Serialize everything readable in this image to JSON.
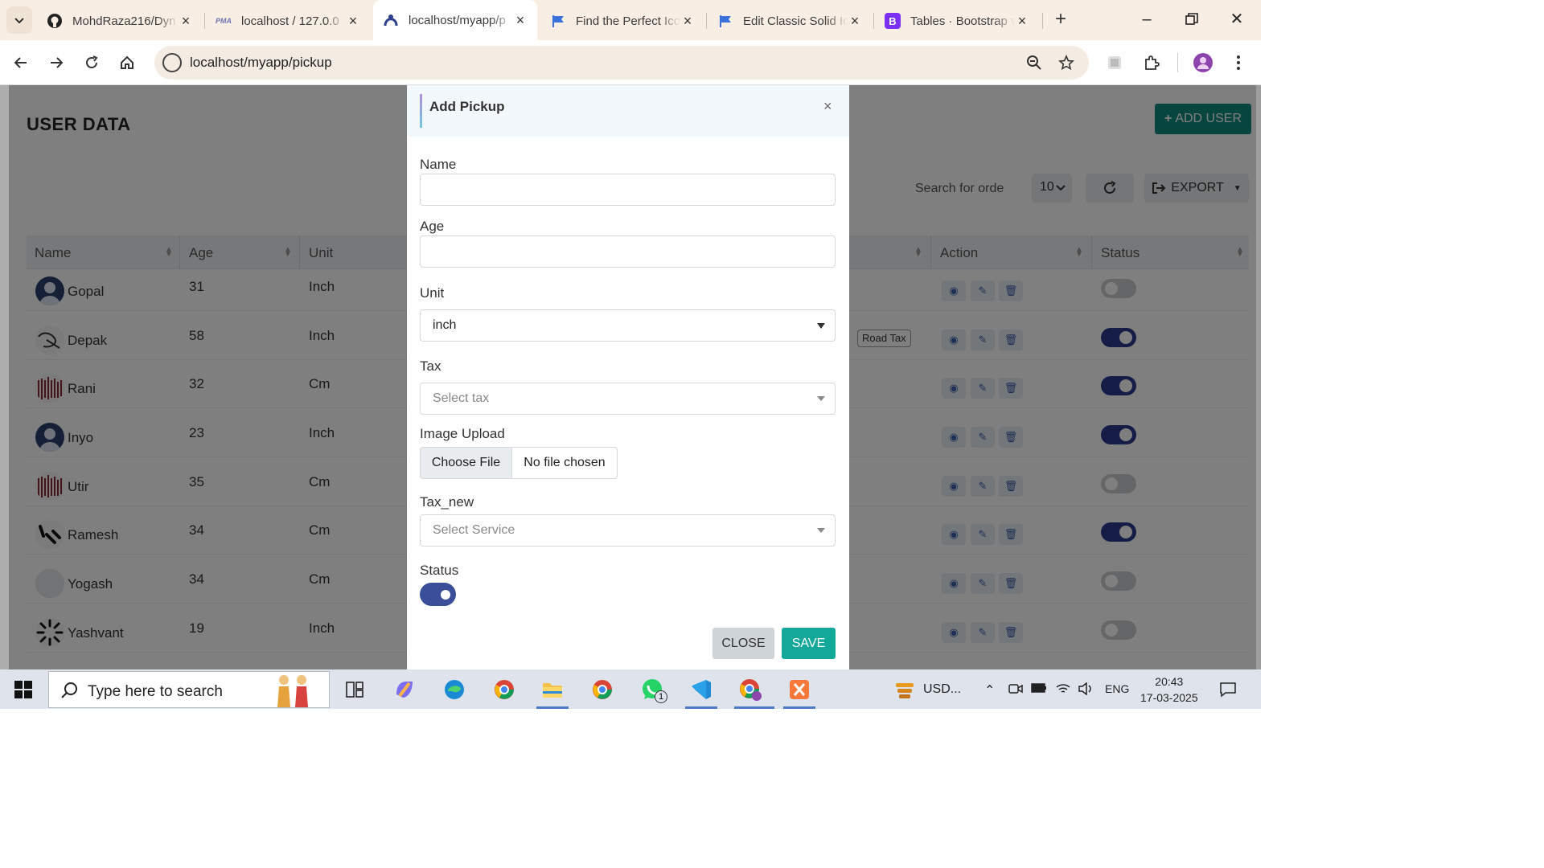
{
  "browser": {
    "tabs": [
      {
        "title": "MohdRaza216/Dyn",
        "icon": "github-icon"
      },
      {
        "title": "localhost / 127.0.0",
        "icon": "phpmyadmin-icon"
      },
      {
        "title": "localhost/myapp/p",
        "icon": "app-logo-icon"
      },
      {
        "title": "Find the Perfect Ico",
        "icon": "fontawesome-flag-icon"
      },
      {
        "title": "Edit Classic Solid Ic",
        "icon": "fontawesome-flag-icon"
      },
      {
        "title": "Tables · Bootstrap v",
        "icon": "bootstrap-icon"
      }
    ],
    "url": "localhost/myapp/pickup",
    "bootstrap_letter": "B",
    "pma_label": "PMA"
  },
  "page": {
    "title": "USER DATA",
    "add_user_label": "ADD USER",
    "search_placeholder": "Search for orde",
    "per_page": "10",
    "export_label": "EXPORT",
    "columns": [
      "Name",
      "Age",
      "Unit",
      "Action",
      "Status"
    ],
    "rows": [
      {
        "name": "Gopal",
        "age": "31",
        "unit": "Inch",
        "status": false
      },
      {
        "name": "Depak",
        "age": "58",
        "unit": "Inch",
        "status": true,
        "tag": "Road Tax"
      },
      {
        "name": "Rani",
        "age": "32",
        "unit": "Cm",
        "status": true
      },
      {
        "name": "Inyo",
        "age": "23",
        "unit": "Inch",
        "status": true
      },
      {
        "name": "Utir",
        "age": "35",
        "unit": "Cm",
        "status": false
      },
      {
        "name": "Ramesh",
        "age": "34",
        "unit": "Cm",
        "status": true
      },
      {
        "name": "Yogash",
        "age": "34",
        "unit": "Cm",
        "status": false
      },
      {
        "name": "Yashvant",
        "age": "19",
        "unit": "Inch",
        "status": false
      }
    ]
  },
  "modal": {
    "title": "Add Pickup",
    "close_x": "×",
    "name_label": "Name",
    "name_value": "",
    "age_label": "Age",
    "age_value": "",
    "unit_label": "Unit",
    "unit_value": "inch",
    "tax_label": "Tax",
    "tax_placeholder": "Select tax",
    "image_label": "Image Upload",
    "choose_file": "Choose File",
    "no_file": "No file chosen",
    "tax_new_label": "Tax_new",
    "tax_new_placeholder": "Select Service",
    "status_label": "Status",
    "status_on": true,
    "close_button": "CLOSE",
    "save_button": "SAVE"
  },
  "taskbar": {
    "search_placeholder": "Type here to search",
    "tray_weather": "USD...",
    "language": "ENG",
    "time": "20:43",
    "date": "17-03-2025",
    "whatsapp_badge": "1"
  },
  "colors": {
    "accent_teal": "#14a89a",
    "toggle_on": "#2a3a8c",
    "tab_strip": "#f9eee3"
  }
}
